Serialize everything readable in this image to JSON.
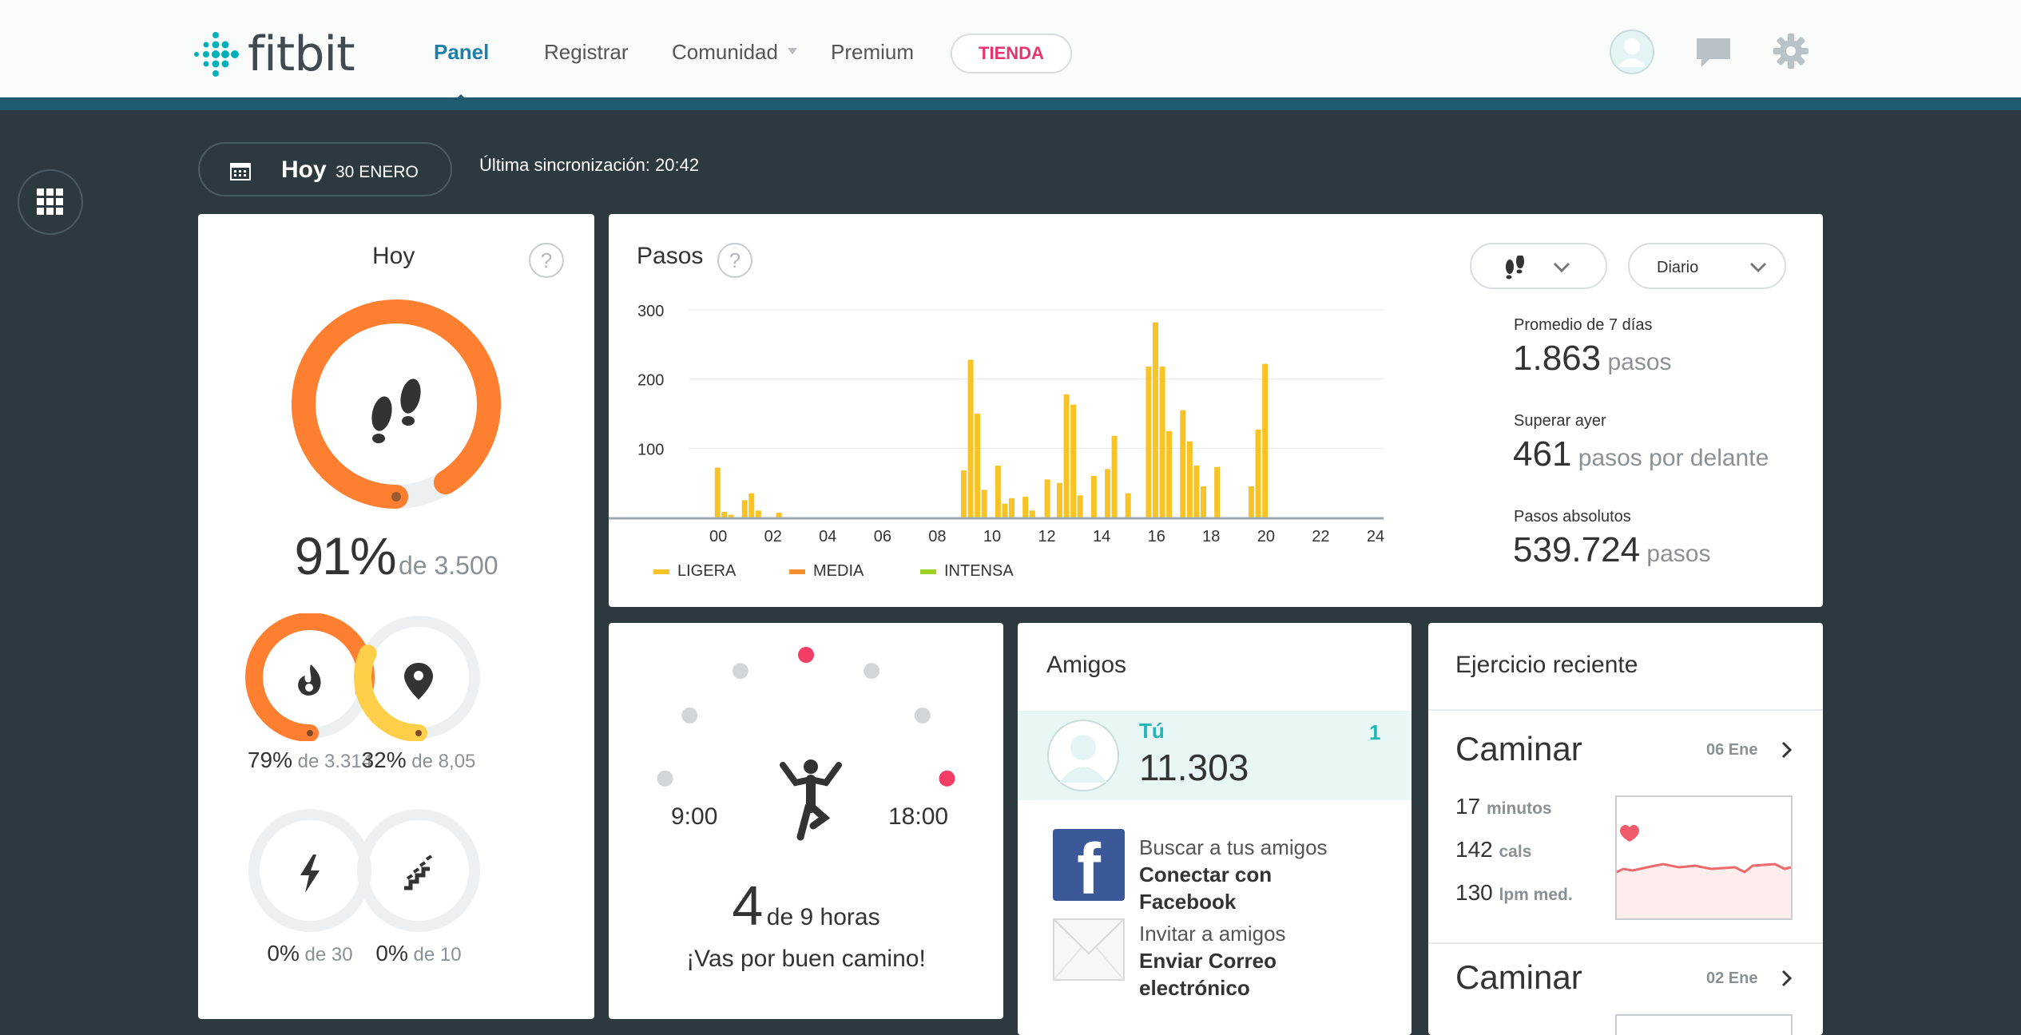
{
  "app": {
    "logo_text": "fitbit"
  },
  "nav": {
    "items": [
      "Panel",
      "Registrar",
      "Comunidad",
      "Premium"
    ],
    "shop_label": "TIENDA"
  },
  "subbar": {
    "date_today": "Hoy",
    "date_day": "30 ENERO",
    "sync_text": "Última sincronización: 20:42"
  },
  "today_card": {
    "title": "Hoy",
    "help": "?",
    "steps_percent": "91%",
    "steps_goal": "de 3.500",
    "steps_progress": 0.91,
    "stats": [
      {
        "icon": "flame-icon",
        "percent": "79%",
        "goal": "de 3.314",
        "progress": 0.79,
        "color": "#ff7f30"
      },
      {
        "icon": "location-pin-icon",
        "percent": "32%",
        "goal": "de 8,05",
        "progress": 0.32,
        "color": "#ffcf4a"
      },
      {
        "icon": "lightning-icon",
        "percent": "0%",
        "goal": "de 30",
        "progress": 0,
        "color": "#ff7f30"
      },
      {
        "icon": "stairs-icon",
        "percent": "0%",
        "goal": "de 10",
        "progress": 0,
        "color": "#ff7f30"
      }
    ]
  },
  "steps_card": {
    "title": "Pasos",
    "help": "?",
    "period_select": "Diario",
    "stats": [
      {
        "label": "Promedio de 7 días",
        "value": "1.863",
        "unit": "pasos"
      },
      {
        "label": "Superar ayer",
        "value": "461",
        "unit": "pasos por delante"
      },
      {
        "label": "Pasos absolutos",
        "value": "539.724",
        "unit": "pasos"
      }
    ],
    "legend": [
      {
        "label": "LIGERA",
        "color": "#f7c325"
      },
      {
        "label": "MEDIA",
        "color": "#f58f2e"
      },
      {
        "label": "INTENSA",
        "color": "#9fd122"
      }
    ]
  },
  "chart_data": {
    "type": "bar",
    "title": "Pasos",
    "xlabel": "",
    "ylabel": "",
    "ylim": [
      0,
      300
    ],
    "yticks": [
      100,
      200,
      300
    ],
    "xlim": [
      -0.5,
      24
    ],
    "xticks": [
      "00",
      "02",
      "04",
      "06",
      "08",
      "10",
      "12",
      "14",
      "16",
      "18",
      "20",
      "22",
      "24"
    ],
    "x": [
      -0.04,
      0.21,
      0.45,
      0.95,
      1.2,
      1.45,
      2.2,
      8.95,
      9.2,
      9.45,
      9.7,
      10.2,
      10.45,
      10.7,
      11.2,
      11.45,
      12.0,
      12.45,
      12.7,
      12.95,
      13.2,
      13.7,
      14.2,
      14.45,
      14.95,
      15.7,
      15.95,
      16.2,
      16.45,
      16.95,
      17.2,
      17.45,
      17.7,
      18.2,
      19.45,
      19.7,
      19.95
    ],
    "values": [
      72,
      8,
      4,
      25,
      35,
      10,
      7,
      68,
      228,
      150,
      40,
      75,
      20,
      28,
      30,
      10,
      55,
      50,
      178,
      163,
      32,
      60,
      70,
      118,
      35,
      218,
      282,
      218,
      125,
      155,
      110,
      75,
      45,
      73,
      45,
      127,
      222
    ],
    "bar_color": "#f7c325"
  },
  "active_hours_card": {
    "start_label": "9:00",
    "end_label": "18:00",
    "count": "4",
    "count_suffix": "de 9 horas",
    "message": "¡Vas por buen camino!",
    "hours_met": [
      true,
      false,
      false,
      false,
      true,
      false,
      false,
      true,
      true
    ],
    "met_color": "#f23d65",
    "unmet_color": "#d3d6d8"
  },
  "friends_card": {
    "title": "Amigos",
    "me": {
      "name": "Tú",
      "steps": "11.303",
      "rank": "1"
    },
    "actions": [
      {
        "icon": "facebook-icon",
        "line1": "Buscar a tus amigos",
        "line2": "Conectar con",
        "line3": "Facebook"
      },
      {
        "icon": "envelope-icon",
        "line1": "Invitar a amigos",
        "line2": "Enviar Correo",
        "line3": "electrónico"
      }
    ]
  },
  "exercise_card": {
    "title": "Ejercicio reciente",
    "entries": [
      {
        "name": "Caminar",
        "date": "06 Ene",
        "minutes": "17",
        "minutes_unit": "minutos",
        "cals": "142",
        "cals_unit": "cals",
        "bpm": "130",
        "bpm_unit": "lpm med."
      },
      {
        "name": "Caminar",
        "date": "02 Ene"
      }
    ]
  }
}
